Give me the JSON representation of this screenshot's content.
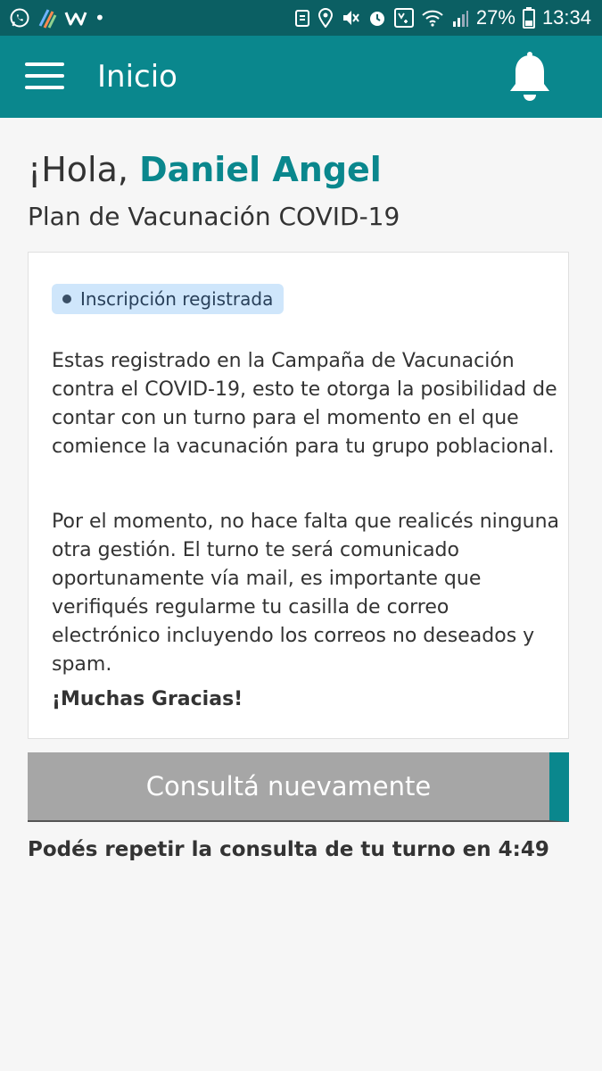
{
  "status_bar": {
    "battery": "27%",
    "time": "13:34",
    "left_icons": [
      "whatsapp-icon",
      "app-shortcut-icon",
      "w-app-icon",
      "dot-indicator"
    ],
    "right_icons": [
      "recycle-icon",
      "location-icon",
      "mute-icon",
      "alarm-icon",
      "volte-icon",
      "wifi-icon",
      "signal-icon",
      "battery-icon"
    ]
  },
  "app_bar": {
    "title": "Inicio",
    "menu_icon": "hamburger-menu-icon",
    "notifications_icon": "bell-icon",
    "color": "#0a878d"
  },
  "greeting": {
    "prefix": "¡Hola, ",
    "name": "Daniel Angel"
  },
  "subtitle": "Plan de Vacunación COVID-19",
  "card": {
    "badge": "Inscripción registrada",
    "paragraph1": "Estas registrado en la Campaña de Vacunación contra el COVID-19, esto te otorga la posibilidad de contar con un turno para el momento en el que comience la vacunación para tu grupo poblacional.",
    "paragraph2": "Por el momento, no hace falta que realicés ninguna otra gestión. El turno te será comunicado oportunamente vía mail, es importante que verifiqués regularme tu casilla de correo electrónico incluyendo los correos no deseados y spam.",
    "thanks": "¡Muchas Gracias!"
  },
  "retry_button": {
    "label": "Consultá nuevamente"
  },
  "countdown_note": "Podés repetir la consulta de tu turno en 4:49"
}
